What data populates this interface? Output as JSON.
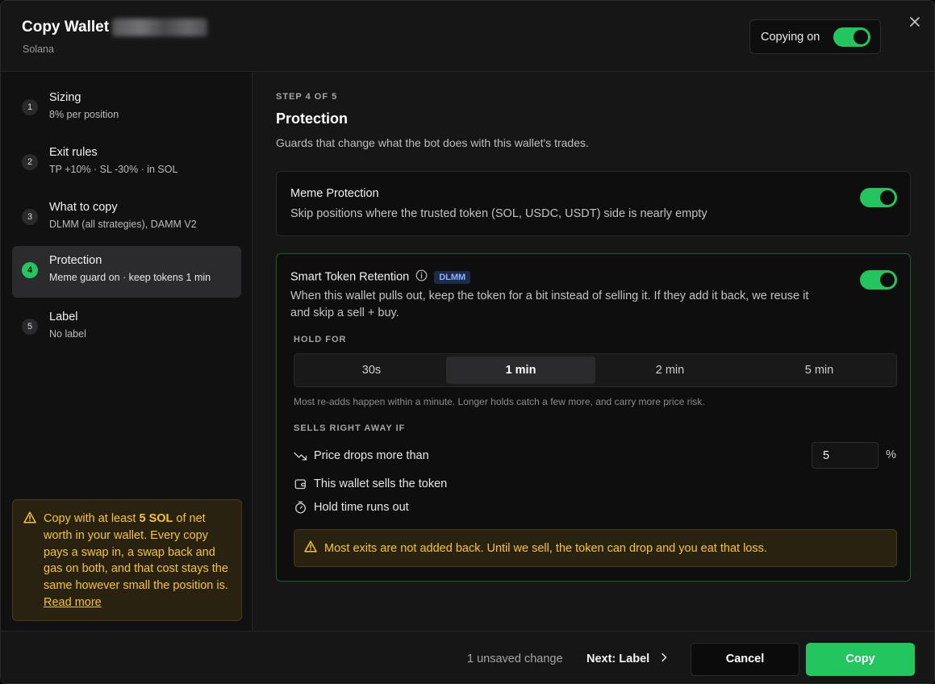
{
  "header": {
    "title": "Copy Wallet",
    "subtitle": "Solana",
    "copying_label": "Copying on",
    "copying_enabled": true,
    "close_icon": "close-icon"
  },
  "sidebar": {
    "steps": [
      {
        "number": "1",
        "title": "Sizing",
        "subtitle": "8% per position",
        "active": false
      },
      {
        "number": "2",
        "title": "Exit rules",
        "subtitle": "TP +10% · SL -30% · in SOL",
        "active": false
      },
      {
        "number": "3",
        "title": "What to copy",
        "subtitle": "DLMM (all strategies), DAMM V2",
        "active": false
      },
      {
        "number": "4",
        "title": "Protection",
        "subtitle": "Meme guard on · keep tokens 1 min",
        "active": true
      },
      {
        "number": "5",
        "title": "Label",
        "subtitle": "No label",
        "active": false
      }
    ],
    "warning": {
      "icon": "warning-triangle-icon",
      "text_before": "Copy with at least ",
      "text_bold": "5 SOL",
      "text_after": " of net worth in your wallet. Every copy pays a swap in, a swap back and gas on both, and that cost stays the same however small the position is. ",
      "link": "Read more"
    }
  },
  "main": {
    "step_label": "STEP 4 OF 5",
    "title": "Protection",
    "description": "Guards that change what the bot does with this wallet's trades.",
    "meme_protection": {
      "title": "Meme Protection",
      "description": "Skip positions where the trusted token (SOL, USDC, USDT) side is nearly empty",
      "enabled": true
    },
    "smart_retention": {
      "title": "Smart Token Retention",
      "badge": "DLMM",
      "description_line1": "When this wallet pulls out, keep the token for a bit instead of selling it. If they add it back, we reuse it",
      "description_line2": "and skip a sell + buy.",
      "enabled": true,
      "hold_for_label": "HOLD FOR",
      "hold_options": [
        "30s",
        "1 min",
        "2 min",
        "5 min"
      ],
      "hold_selected": "1 min",
      "hold_hint": "Most re-adds happen within a minute. Longer holds catch a few more, and carry more price risk.",
      "sells_label": "SELLS RIGHT AWAY IF",
      "conditions": [
        {
          "icon": "trending-down-icon",
          "label": "Price drops more than"
        },
        {
          "icon": "wallet-icon",
          "label": "This wallet sells the token"
        },
        {
          "icon": "stopwatch-icon",
          "label": "Hold time runs out"
        }
      ],
      "price_drop_value": "5",
      "price_drop_unit": "%",
      "warning": "Most exits are not added back. Until we sell, the token can drop and you eat that loss."
    }
  },
  "footer": {
    "unsaved": "1 unsaved change",
    "next_label": "Next: Label",
    "cancel_label": "Cancel",
    "copy_label": "Copy"
  },
  "colors": {
    "accent": "#22c55e",
    "warning_text": "#f5c52e",
    "warning_bg": "#2a2210",
    "badge_text": "#8ab4ff"
  }
}
